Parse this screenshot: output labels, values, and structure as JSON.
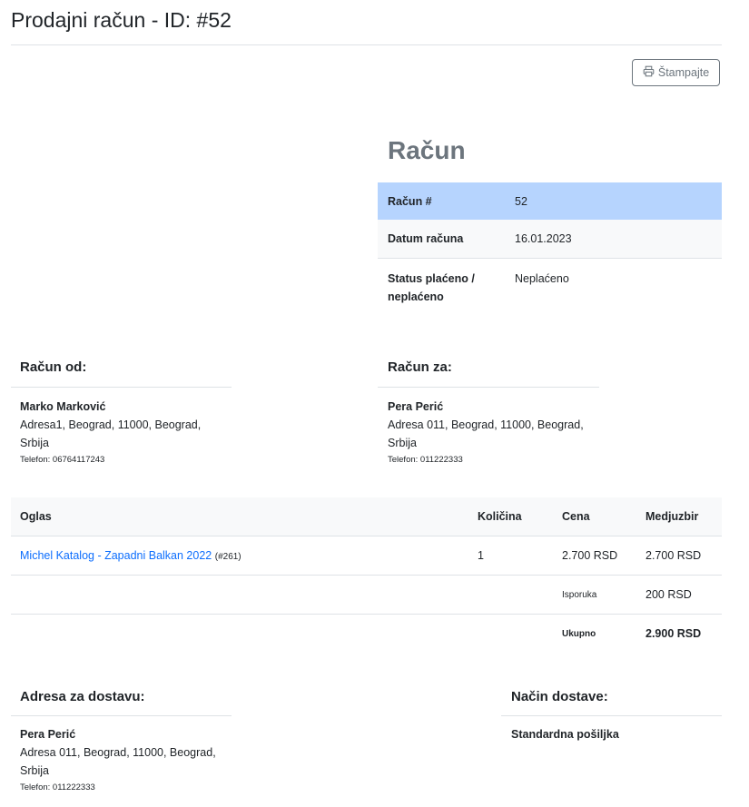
{
  "page": {
    "title": "Prodajni račun - ID: #52"
  },
  "toolbar": {
    "print_label": "Štampajte"
  },
  "invoice": {
    "heading": "Račun",
    "rows": [
      {
        "label": "Račun #",
        "value": "52"
      },
      {
        "label": "Datum računa",
        "value": "16.01.2023"
      },
      {
        "label": "Status plaćeno / neplaćeno",
        "value": "Neplaćeno"
      }
    ]
  },
  "from": {
    "title": "Račun od:",
    "name": "Marko Marković",
    "address": "Adresa1, Beograd, 11000, Beograd, Srbija",
    "phone": "Telefon: 06764117243"
  },
  "to": {
    "title": "Račun za:",
    "name": "Pera Perić",
    "address": "Adresa 011, Beograd, 11000, Beograd, Srbija",
    "phone": "Telefon: 011222333"
  },
  "items": {
    "headers": {
      "ad": "Oglas",
      "qty": "Količina",
      "price": "Cena",
      "subtotal": "Medjuzbir"
    },
    "rows": [
      {
        "ad": "Michel Katalog - Zapadni Balkan 2022",
        "ad_id": "(#261)",
        "qty": "1",
        "price": "2.700 RSD",
        "subtotal": "2.700 RSD"
      }
    ],
    "shipping": {
      "label": "Isporuka",
      "value": "200 RSD"
    },
    "total": {
      "label": "Ukupno",
      "value": "2.900 RSD"
    }
  },
  "shipping_address": {
    "title": "Adresa za dostavu:",
    "name": "Pera Perić",
    "address": "Adresa 011, Beograd, 11000, Beograd, Srbija",
    "phone": "Telefon: 011222333"
  },
  "shipping_method": {
    "title": "Način dostave:",
    "value": "Standardna pošiljka"
  },
  "icons": {
    "print": "printer-icon"
  }
}
